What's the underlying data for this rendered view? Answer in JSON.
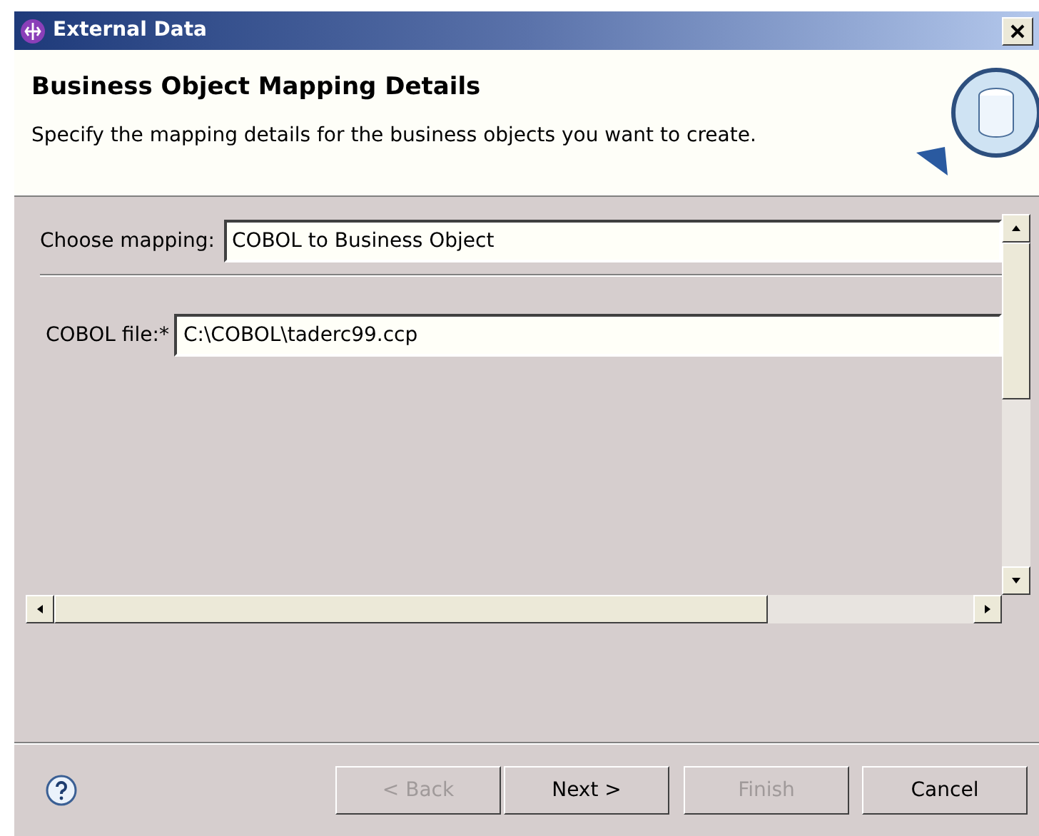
{
  "window": {
    "title": "External Data"
  },
  "header": {
    "title": "Business Object Mapping Details",
    "description": "Specify the mapping details for the business objects you want to create."
  },
  "mapping": {
    "label": "Choose mapping:",
    "value": "COBOL to Business Object"
  },
  "file": {
    "label": "COBOL file:",
    "required_mark": "*",
    "value": "C:\\COBOL\\taderc99.ccp"
  },
  "buttons": [
    {
      "label": "< Back",
      "disabled": true
    },
    {
      "label": "Next >",
      "disabled": false
    },
    {
      "label": "Finish",
      "disabled": true
    },
    {
      "label": "Cancel",
      "disabled": false
    }
  ]
}
